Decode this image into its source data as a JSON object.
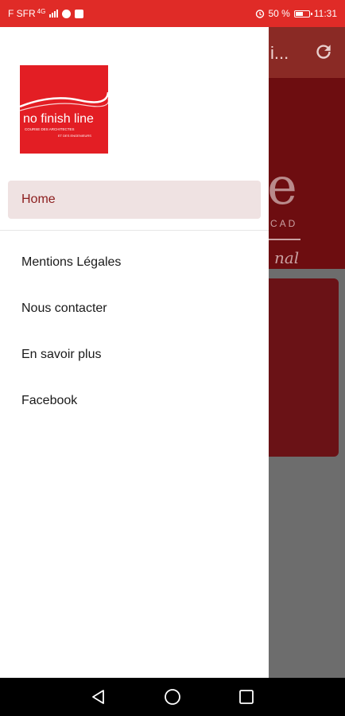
{
  "status_bar": {
    "carrier": "F SFR",
    "network": "4G",
    "battery": "50 %",
    "time": "11:31"
  },
  "background_app": {
    "title": "i...",
    "banner_text_1": "e",
    "banner_text_2": "CAD",
    "banner_text_3": "nal"
  },
  "drawer": {
    "logo": {
      "brand": "no finish line",
      "tagline": "COURSE DES ARCHITECTES",
      "sub": "ET DES ENGENIEURS"
    },
    "items": [
      {
        "label": "Home",
        "active": true
      },
      {
        "label": "Mentions Légales",
        "active": false
      },
      {
        "label": "Nous contacter",
        "active": false
      },
      {
        "label": "En savoir plus",
        "active": false
      },
      {
        "label": "Facebook",
        "active": false
      }
    ]
  },
  "nav_bar": {
    "buttons": [
      "back-icon",
      "home-icon",
      "recents-icon"
    ]
  },
  "colors": {
    "status_bar": "#e02b27",
    "logo_red": "#e31e24",
    "active_bg": "#efe2e2",
    "active_text": "#8b1d1d",
    "scrim": "#6d6d6d"
  }
}
